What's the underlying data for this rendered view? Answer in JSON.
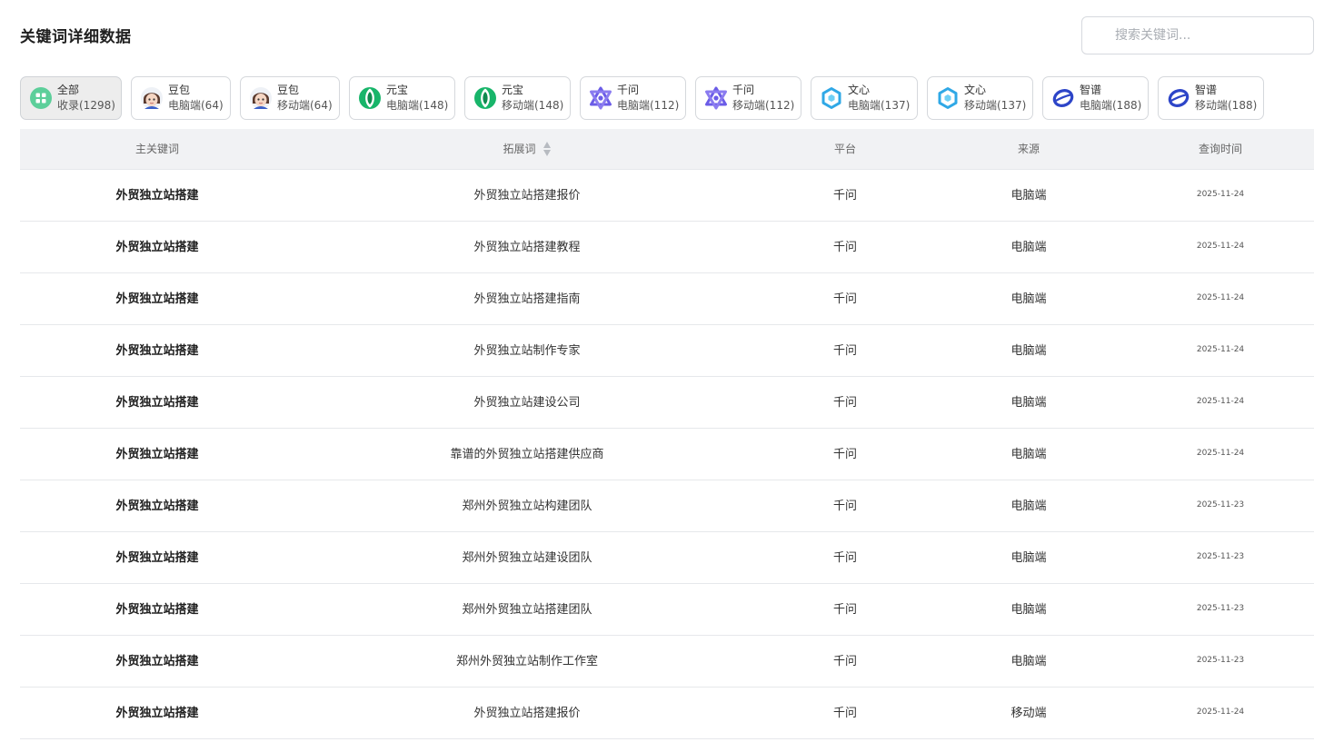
{
  "page": {
    "title": "关键词详细数据",
    "search_placeholder": "搜索关键词..."
  },
  "filters": [
    {
      "line1": "全部",
      "line2": "收录(1298)",
      "icon": "grid-icon",
      "active": true
    },
    {
      "line1": "豆包",
      "line2": "电脑端(64)",
      "icon": "doubao-avatar-icon"
    },
    {
      "line1": "豆包",
      "line2": "移动端(64)",
      "icon": "doubao-avatar-icon"
    },
    {
      "line1": "元宝",
      "line2": "电脑端(148)",
      "icon": "yuanbao-icon"
    },
    {
      "line1": "元宝",
      "line2": "移动端(148)",
      "icon": "yuanbao-icon"
    },
    {
      "line1": "千问",
      "line2": "电脑端(112)",
      "icon": "qianwen-icon"
    },
    {
      "line1": "千问",
      "line2": "移动端(112)",
      "icon": "qianwen-icon"
    },
    {
      "line1": "文心",
      "line2": "电脑端(137)",
      "icon": "wenxin-icon"
    },
    {
      "line1": "文心",
      "line2": "移动端(137)",
      "icon": "wenxin-icon"
    },
    {
      "line1": "智谱",
      "line2": "电脑端(188)",
      "icon": "zhipu-icon"
    },
    {
      "line1": "智谱",
      "line2": "移动端(188)",
      "icon": "zhipu-icon"
    }
  ],
  "table": {
    "headers": {
      "main_keyword": "主关键词",
      "expanded_keyword": "拓展词",
      "platform": "平台",
      "source": "来源",
      "query_time": "查询时间"
    },
    "rows": [
      {
        "main": "外贸独立站搭建",
        "expanded": "外贸独立站搭建报价",
        "platform": "千问",
        "source": "电脑端",
        "date": "2025-11-24"
      },
      {
        "main": "外贸独立站搭建",
        "expanded": "外贸独立站搭建教程",
        "platform": "千问",
        "source": "电脑端",
        "date": "2025-11-24"
      },
      {
        "main": "外贸独立站搭建",
        "expanded": "外贸独立站搭建指南",
        "platform": "千问",
        "source": "电脑端",
        "date": "2025-11-24"
      },
      {
        "main": "外贸独立站搭建",
        "expanded": "外贸独立站制作专家",
        "platform": "千问",
        "source": "电脑端",
        "date": "2025-11-24"
      },
      {
        "main": "外贸独立站搭建",
        "expanded": "外贸独立站建设公司",
        "platform": "千问",
        "source": "电脑端",
        "date": "2025-11-24"
      },
      {
        "main": "外贸独立站搭建",
        "expanded": "靠谱的外贸独立站搭建供应商",
        "platform": "千问",
        "source": "电脑端",
        "date": "2025-11-24"
      },
      {
        "main": "外贸独立站搭建",
        "expanded": "郑州外贸独立站构建团队",
        "platform": "千问",
        "source": "电脑端",
        "date": "2025-11-23"
      },
      {
        "main": "外贸独立站搭建",
        "expanded": "郑州外贸独立站建设团队",
        "platform": "千问",
        "source": "电脑端",
        "date": "2025-11-23"
      },
      {
        "main": "外贸独立站搭建",
        "expanded": "郑州外贸独立站搭建团队",
        "platform": "千问",
        "source": "电脑端",
        "date": "2025-11-23"
      },
      {
        "main": "外贸独立站搭建",
        "expanded": "郑州外贸独立站制作工作室",
        "platform": "千问",
        "source": "电脑端",
        "date": "2025-11-23"
      },
      {
        "main": "外贸独立站搭建",
        "expanded": "外贸独立站搭建报价",
        "platform": "千问",
        "source": "移动端",
        "date": "2025-11-24"
      }
    ]
  },
  "colors": {
    "grid_icon": "#5ccf9a",
    "yuanbao": "#18b56a",
    "qianwen": "#6b5ce7",
    "wenxin": "#2fa8e6",
    "zhipu": "#2d45c8",
    "header_bg": "#f1f2f4"
  }
}
